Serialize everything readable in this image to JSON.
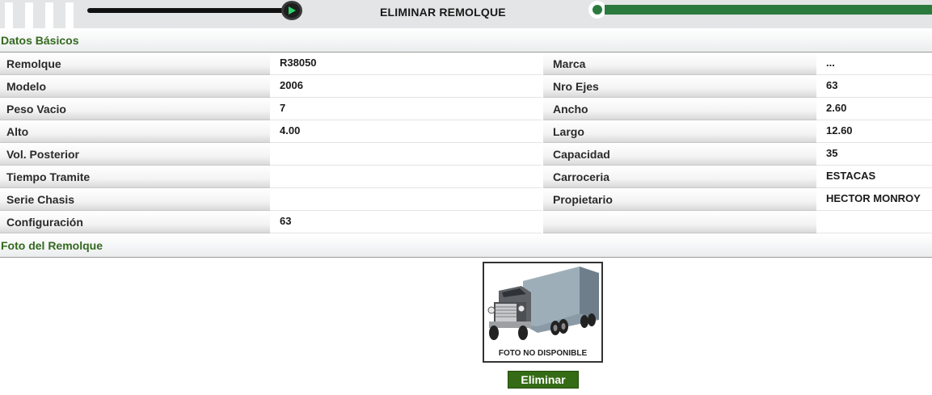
{
  "header": {
    "title": "ELIMINAR REMOLQUE",
    "brand_color": "#2b7a3d"
  },
  "sections": {
    "basic": "Datos Básicos",
    "photo": "Foto del Remolque"
  },
  "rows": [
    {
      "label_left": "Remolque",
      "value_left": "R38050",
      "label_right": "Marca",
      "value_right": "..."
    },
    {
      "label_left": "Modelo",
      "value_left": "2006",
      "label_right": "Nro Ejes",
      "value_right": "63"
    },
    {
      "label_left": "Peso Vacio",
      "value_left": "7",
      "label_right": "Ancho",
      "value_right": "2.60"
    },
    {
      "label_left": "Alto",
      "value_left": "4.00",
      "label_right": "Largo",
      "value_right": "12.60"
    },
    {
      "label_left": "Vol. Posterior",
      "value_left": "",
      "label_right": "Capacidad",
      "value_right": "35"
    },
    {
      "label_left": "Tiempo Tramite",
      "value_left": "",
      "label_right": "Carroceria",
      "value_right": "ESTACAS"
    },
    {
      "label_left": "Serie Chasis",
      "value_left": "",
      "label_right": "Propietario",
      "value_right": "HECTOR MONROY"
    },
    {
      "label_left": "Configuración",
      "value_left": "63",
      "label_right": "",
      "value_right": ""
    }
  ],
  "photo": {
    "caption": "FOTO NO DISPONIBLE",
    "icon": "truck-icon"
  },
  "actions": {
    "delete_label": "Eliminar"
  }
}
